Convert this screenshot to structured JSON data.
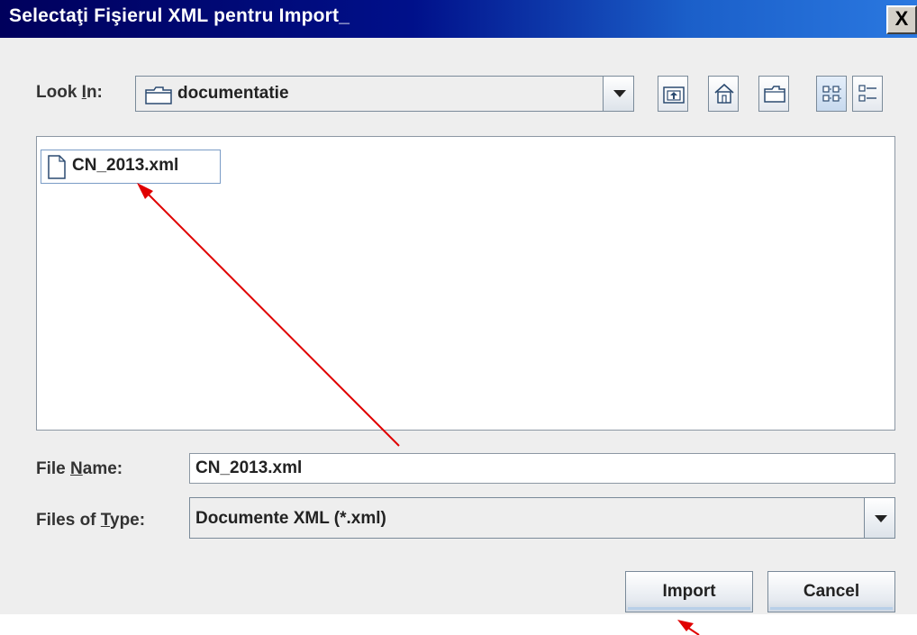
{
  "window": {
    "title": "Selectaţi Fişierul XML pentru Import_",
    "close_glyph": "X"
  },
  "look_in": {
    "label": "Look In:",
    "mnemonic_label_parts": [
      "Look ",
      "I",
      "n:"
    ],
    "value": "documentatie"
  },
  "toolbar": {
    "buttons": [
      {
        "name": "up-one-level"
      },
      {
        "name": "home"
      },
      {
        "name": "new-folder"
      },
      {
        "name": "list-view"
      },
      {
        "name": "details-view"
      }
    ]
  },
  "files": [
    {
      "name": "CN_2013.xml",
      "icon": "file-icon"
    }
  ],
  "file_name": {
    "label_parts": [
      "File ",
      "N",
      "ame:"
    ],
    "value": "CN_2013.xml"
  },
  "file_type": {
    "label_parts": [
      "Files of ",
      "T",
      "ype:"
    ],
    "value": "Documente XML (*.xml)"
  },
  "buttons": {
    "import": "Import",
    "cancel": "Cancel"
  },
  "colors": {
    "title_start": "#00005c",
    "title_end": "#2a78e0",
    "annotation_arrow": "#e00000"
  }
}
